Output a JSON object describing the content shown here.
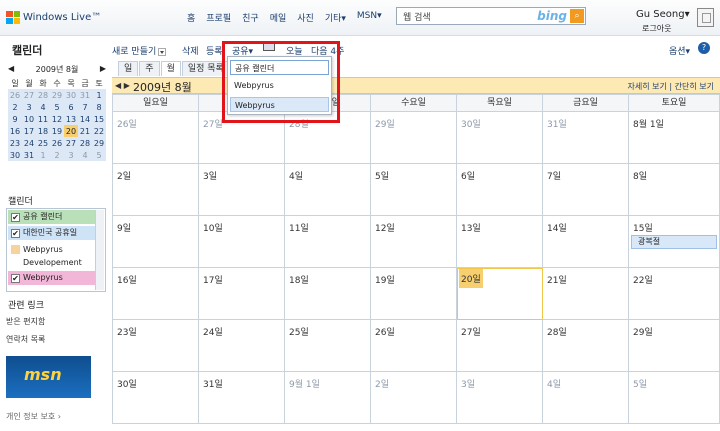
{
  "topbar": {
    "brand": "Windows Live™",
    "nav": [
      "홈",
      "프로필",
      "친구",
      "메일",
      "사진",
      "기타▾",
      "MSN▾"
    ],
    "search_placeholder": "웹 검색",
    "search_engine": "bing",
    "user_name": "Gu Seong▾",
    "logout": "로그아웃"
  },
  "sidebar": {
    "app_title": "캘린더",
    "mini": {
      "prev": "◀",
      "title": "2009년 8월",
      "next": "▶",
      "weekdays": [
        "일",
        "월",
        "화",
        "수",
        "목",
        "금",
        "토"
      ],
      "rows": [
        [
          "26",
          "27",
          "28",
          "29",
          "30",
          "31",
          "1"
        ],
        [
          "2",
          "3",
          "4",
          "5",
          "6",
          "7",
          "8"
        ],
        [
          "9",
          "10",
          "11",
          "12",
          "13",
          "14",
          "15"
        ],
        [
          "16",
          "17",
          "18",
          "19",
          "20",
          "21",
          "22"
        ],
        [
          "23",
          "24",
          "25",
          "26",
          "27",
          "28",
          "29"
        ],
        [
          "30",
          "31",
          "1",
          "2",
          "3",
          "4",
          "5"
        ]
      ]
    },
    "calendars_heading": "캘린더",
    "calendars": [
      {
        "label": "공유 캘린더",
        "checked": "✔",
        "color": "#b9e0b9"
      },
      {
        "label": "대한민국 공휴일",
        "checked": "✔",
        "color": "#cfe3f7"
      },
      {
        "label": "Webpyrus Developement",
        "checked": "",
        "color": "#f7d29c"
      },
      {
        "label": "Webpyrus",
        "checked": "✔",
        "color": "#f1b6d8"
      }
    ],
    "related_heading": "관련 링크",
    "links": [
      "받은 편지함",
      "연락처 목록"
    ],
    "ad_text": "msn",
    "privacy": "개인 정보 보호 ›"
  },
  "toolbar": {
    "new_item": "새로 만들기",
    "delete": "삭제",
    "print": "등록",
    "share": "공유▾",
    "today": "오늘",
    "next": "다음 4주",
    "options": "옵션▾",
    "help": "?"
  },
  "view_tabs": [
    "일",
    "주",
    "월",
    "일정 목록"
  ],
  "month_bar": {
    "arrows": "◀ ▶",
    "title": "2009년 8월",
    "detail": "자세히 보기",
    "separator": "|",
    "simple": "간단히 보기"
  },
  "weekdays": [
    "일요일",
    "월요일",
    "화요일",
    "수요일",
    "목요일",
    "금요일",
    "토요일"
  ],
  "weeks": [
    [
      "26일",
      "27일",
      "28일",
      "29일",
      "30일",
      "31일",
      "8월 1일"
    ],
    [
      "2일",
      "3일",
      "4일",
      "5일",
      "6일",
      "7일",
      "8일"
    ],
    [
      "9일",
      "10일",
      "11일",
      "12일",
      "13일",
      "14일",
      "15일"
    ],
    [
      "16일",
      "17일",
      "18일",
      "19일",
      "20일",
      "21일",
      "22일"
    ],
    [
      "23일",
      "24일",
      "25일",
      "26일",
      "27일",
      "28일",
      "29일"
    ],
    [
      "30일",
      "31일",
      "9월 1일",
      "2일",
      "3일",
      "4일",
      "5일"
    ]
  ],
  "events": {
    "w2d6": "광복절"
  },
  "share_menu": [
    "공유 캘린더",
    "Webpyrus Developement",
    "Webpyrus"
  ],
  "colors": {
    "today": "#f7cf6f",
    "month_bar": "#fde9b4",
    "highlight": "#e1141a",
    "event": "#d9e8f8"
  }
}
